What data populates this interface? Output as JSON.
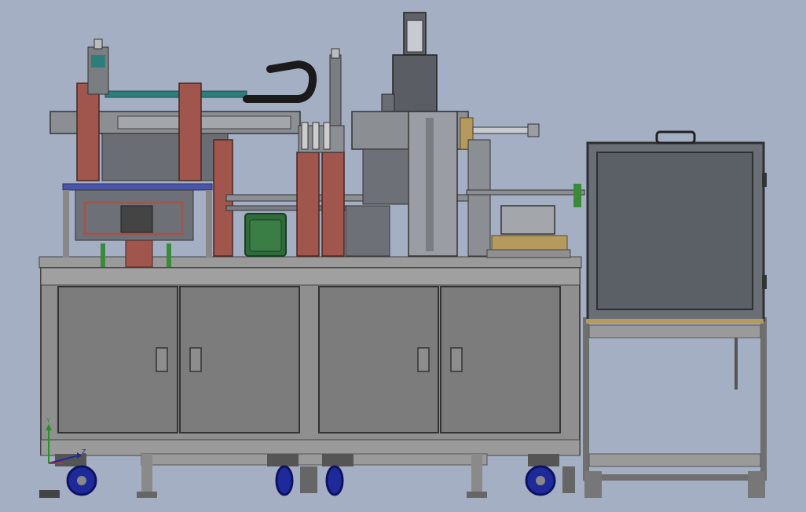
{
  "scene": {
    "background": "#a4afc3",
    "colors": {
      "frame": "#9a9a9a",
      "frame_dark": "#6f6f6f",
      "panel": "#7c7c7c",
      "panel_edge": "#3a3a3a",
      "machine_dark": "#5a5d63",
      "machine_mid": "#8b8e93",
      "red_plate": "#a0554d",
      "teal_rail": "#2d7d7a",
      "green_motor": "#2f6b3a",
      "wheel_blue": "#1f2a9a",
      "cabinet": "#5b5f66",
      "cabinet_border": "#2e3033",
      "cable": "#1a1a1a",
      "wood_plate": "#b49a5c"
    },
    "axis_labels": {
      "y": "Y",
      "z": "Z"
    }
  }
}
